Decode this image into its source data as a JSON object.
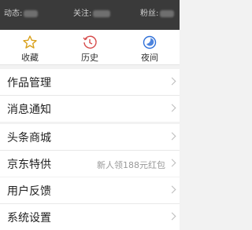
{
  "stats": {
    "posts_label": "动态:",
    "follow_label": "关注:",
    "fans_label": "粉丝:"
  },
  "quick": [
    {
      "label": "收藏",
      "icon": "star-icon"
    },
    {
      "label": "历史",
      "icon": "history-clock-icon"
    },
    {
      "label": "夜间",
      "icon": "night-mode-icon"
    }
  ],
  "menu": {
    "works": "作品管理",
    "messages": "消息通知",
    "mall": "头条商城",
    "jd": "京东特供",
    "jd_extra": "新人领188元红包",
    "feedback": "用户反馈",
    "settings": "系统设置"
  },
  "colors": {
    "accent": "#2e6fd8",
    "header_bg": "#3a3a3a"
  }
}
